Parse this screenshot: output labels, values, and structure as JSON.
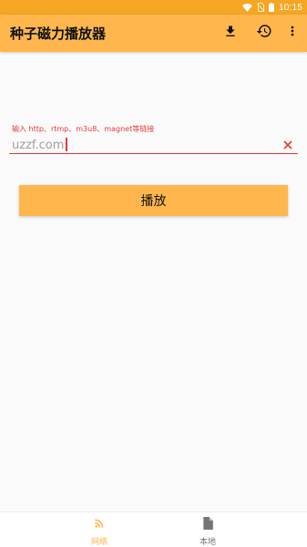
{
  "status_bar": {
    "time": "10:15",
    "icons": [
      "wifi-icon",
      "no-sim-icon",
      "battery-icon"
    ]
  },
  "app_bar": {
    "title": "种子磁力播放器",
    "actions": [
      "download-icon",
      "history-icon",
      "more-vert-icon"
    ]
  },
  "url_input": {
    "hint": "输入 http、rtmp、m3u8、magnet等链接",
    "value": "uzzf.com",
    "clear_icon": "close-icon"
  },
  "play_button": {
    "label": "播放"
  },
  "bottom_nav": {
    "items": [
      {
        "label": "网络",
        "icon": "rss-feed-icon",
        "active": true
      },
      {
        "label": "本地",
        "icon": "file-icon",
        "active": false
      }
    ]
  },
  "colors": {
    "status_bar": "#f5a623",
    "app_bar": "#ffb74d",
    "accent_red": "#e53935",
    "nav_active": "#ffb74d",
    "nav_inactive": "#757575",
    "background": "#fafafa"
  }
}
